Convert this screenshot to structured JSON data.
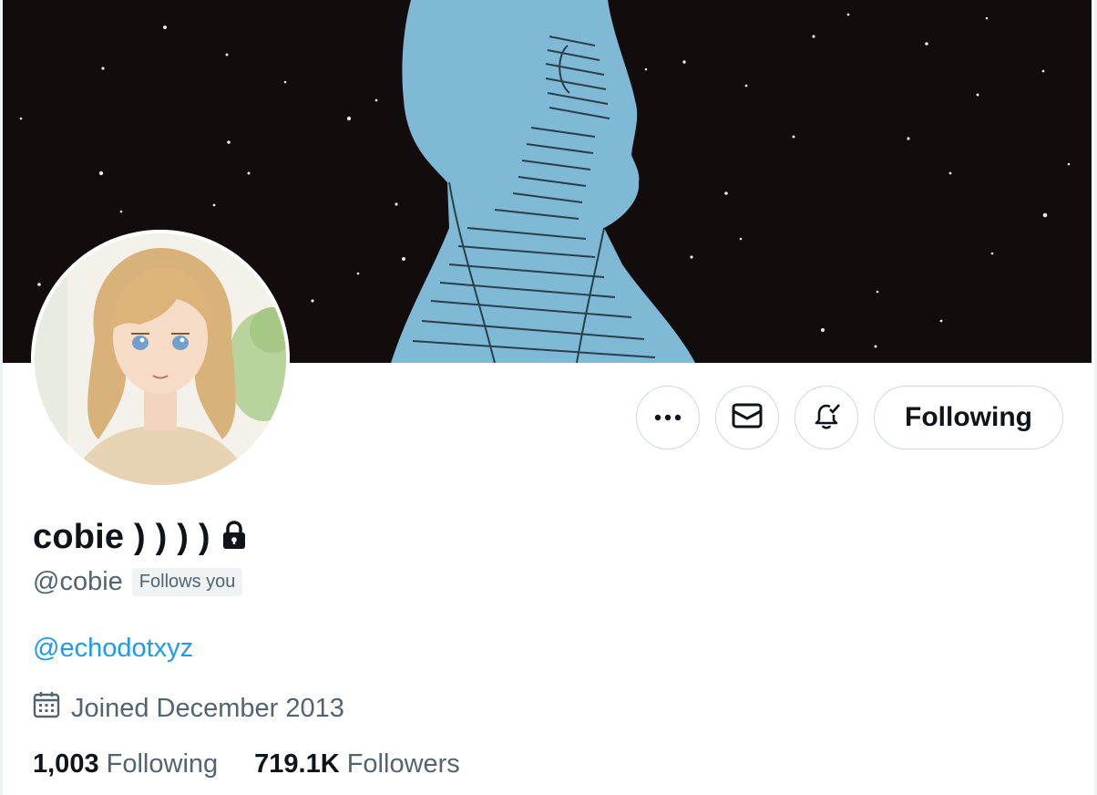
{
  "profile": {
    "display_name": "cobie ) ) ) )",
    "handle": "@cobie",
    "follows_you_badge": "Follows you",
    "bio_link": "@echodotxyz",
    "joined": "Joined December 2013",
    "following_count": "1,003",
    "following_label": "Following",
    "followers_count": "719.1K",
    "followers_label": "Followers"
  },
  "actions": {
    "more_icon": "more-dots-icon",
    "message_icon": "envelope-icon",
    "notify_icon": "bell-check-icon",
    "follow_button_label": "Following"
  },
  "icons": {
    "lock": "lock-icon",
    "calendar": "calendar-icon"
  },
  "colors": {
    "text_primary": "#0f1419",
    "text_secondary": "#536471",
    "link": "#1d9bf0",
    "border": "#cfd9de",
    "banner_bg": "#120d0c",
    "banner_figure": "#7fb9d6"
  }
}
